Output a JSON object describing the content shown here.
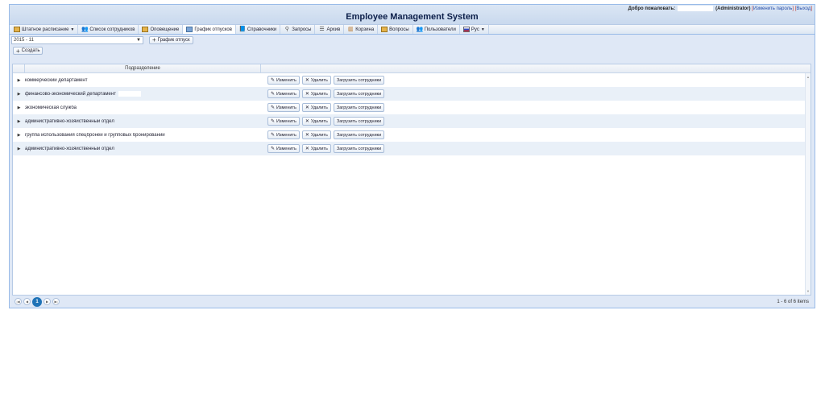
{
  "header": {
    "title": "Employee Management System",
    "welcome_label": "Добро пожаловать:",
    "user_role": "(Administrator)",
    "change_password": "Изменить пароль",
    "logout": "Выход"
  },
  "menu": [
    {
      "label": "Штатное расписание",
      "icon": "grid-icon",
      "dropdown": true
    },
    {
      "label": "Список сотрудников",
      "icon": "users-icon"
    },
    {
      "label": "Оповещение",
      "icon": "grid-icon"
    },
    {
      "label": "График отпусков",
      "icon": "table-icon",
      "active": true
    },
    {
      "label": "Справочники",
      "icon": "book-icon"
    },
    {
      "label": "Запросы",
      "icon": "search-icon"
    },
    {
      "label": "Архив",
      "icon": "archive-icon"
    },
    {
      "label": "Корзина",
      "icon": "bin-icon"
    },
    {
      "label": "Вопросы",
      "icon": "grid-icon"
    },
    {
      "label": "Пользователи",
      "icon": "users-icon"
    },
    {
      "label": "Рус",
      "icon": "flag-icon",
      "dropdown": true
    }
  ],
  "filter": {
    "period_value": "2015 - 11",
    "schedule_button": "График отпуск"
  },
  "toolbar": {
    "create_button": "Создать"
  },
  "grid": {
    "column_header": "Подразделение",
    "actions": {
      "edit": "Изменить",
      "delete": "Удалить",
      "load": "Загрузить сотрудники"
    },
    "rows": [
      {
        "dept": "коммерческий департамент"
      },
      {
        "dept": "финансово-экономический департамент"
      },
      {
        "dept": "экономическая служба"
      },
      {
        "dept": "административно-хозяйственный отдел"
      },
      {
        "dept": "группа использования спецброней и групповых бронирований"
      },
      {
        "dept": "административно-хозяйственный отдел"
      }
    ]
  },
  "pager": {
    "current_page": "1",
    "items_info": "1 - 6 of 6 items"
  },
  "colors": {
    "accent": "#1f73b7",
    "panel": "#dfe8f6",
    "border": "#99bbe8",
    "title": "#0c1f4a"
  }
}
